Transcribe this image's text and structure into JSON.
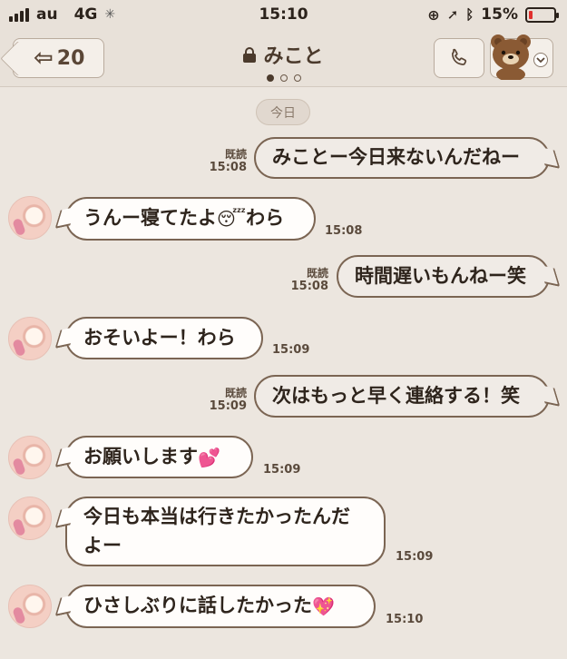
{
  "status_bar": {
    "carrier": "au",
    "network": "4G",
    "time": "15:10",
    "battery": "15%",
    "battery_level": 0.15
  },
  "header": {
    "back_count": "20",
    "title": "みこと",
    "page_dots": 3,
    "active_dot": 0
  },
  "date_label": "今日",
  "messages": [
    {
      "dir": "out",
      "text": "みことー今日来ないんだねー",
      "read": "既読",
      "time": "15:08"
    },
    {
      "dir": "in",
      "text": "うんー寝てたよ",
      "emoji": "😴",
      "text_after": "わら",
      "time": "15:08"
    },
    {
      "dir": "out",
      "text": "時間遅いもんねー笑",
      "read": "既読",
      "time": "15:08"
    },
    {
      "dir": "in",
      "text": "おそいよー！わら",
      "time": "15:09"
    },
    {
      "dir": "out",
      "text": "次はもっと早く連絡する！笑",
      "read": "既読",
      "time": "15:09"
    },
    {
      "dir": "in",
      "text": "お願いします",
      "emoji": "💕",
      "time": "15:09"
    },
    {
      "dir": "in",
      "text": "今日も本当は行きたかったんだよー",
      "time": "15:09"
    },
    {
      "dir": "in",
      "text": "ひさしぶりに話したかった",
      "emoji": "💖",
      "time": "15:10"
    }
  ],
  "colors": {
    "background": "#ece6df",
    "bubble_border": "#7b6553",
    "battery_low": "#e0302d"
  }
}
